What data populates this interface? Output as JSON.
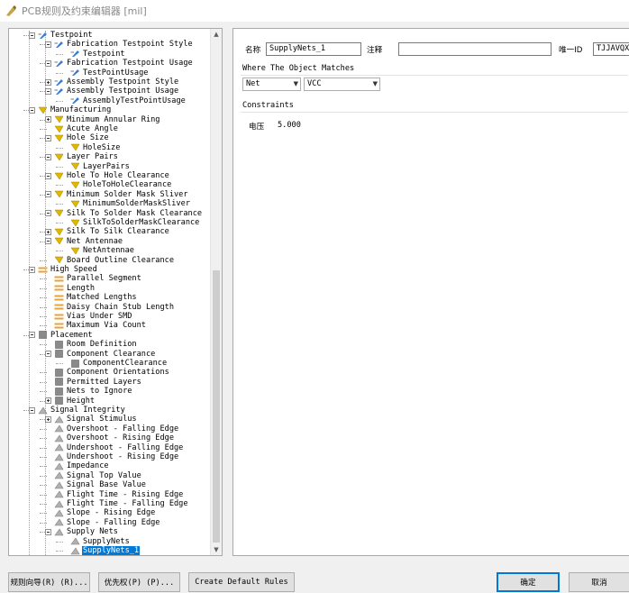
{
  "window": {
    "title": "PCB规则及约束编辑器 [mil]"
  },
  "tree": {
    "items": [
      {
        "label": "Testpoint",
        "level": 1,
        "expander": "minus",
        "icon": "rule"
      },
      {
        "label": "Fabrication Testpoint Style",
        "level": 2,
        "expander": "minus",
        "icon": "rule"
      },
      {
        "label": "Testpoint",
        "level": 3,
        "expander": "none",
        "icon": "rule-item"
      },
      {
        "label": "Fabrication Testpoint Usage",
        "level": 2,
        "expander": "minus",
        "icon": "rule"
      },
      {
        "label": "TestPointUsage",
        "level": 3,
        "expander": "none",
        "icon": "rule-item"
      },
      {
        "label": "Assembly Testpoint Style",
        "level": 2,
        "expander": "plus",
        "icon": "rule"
      },
      {
        "label": "Assembly Testpoint Usage",
        "level": 2,
        "expander": "minus",
        "icon": "rule"
      },
      {
        "label": "AssemblyTestPointUsage",
        "level": 3,
        "expander": "none",
        "icon": "rule-item"
      },
      {
        "label": "Manufacturing",
        "level": 1,
        "expander": "minus",
        "icon": "mfg"
      },
      {
        "label": "Minimum Annular Ring",
        "level": 2,
        "expander": "plus",
        "icon": "mfg"
      },
      {
        "label": "Acute Angle",
        "level": 2,
        "expander": "none",
        "icon": "mfg"
      },
      {
        "label": "Hole Size",
        "level": 2,
        "expander": "minus",
        "icon": "mfg"
      },
      {
        "label": "HoleSize",
        "level": 3,
        "expander": "none",
        "icon": "mfg-item"
      },
      {
        "label": "Layer Pairs",
        "level": 2,
        "expander": "minus",
        "icon": "mfg"
      },
      {
        "label": "LayerPairs",
        "level": 3,
        "expander": "none",
        "icon": "mfg-item"
      },
      {
        "label": "Hole To Hole Clearance",
        "level": 2,
        "expander": "minus",
        "icon": "mfg"
      },
      {
        "label": "HoleToHoleClearance",
        "level": 3,
        "expander": "none",
        "icon": "mfg-item"
      },
      {
        "label": "Minimum Solder Mask Sliver",
        "level": 2,
        "expander": "minus",
        "icon": "mfg"
      },
      {
        "label": "MinimumSolderMaskSliver",
        "level": 3,
        "expander": "none",
        "icon": "mfg-item"
      },
      {
        "label": "Silk To Solder Mask Clearance",
        "level": 2,
        "expander": "minus",
        "icon": "mfg"
      },
      {
        "label": "SilkToSolderMaskClearance",
        "level": 3,
        "expander": "none",
        "icon": "mfg-item"
      },
      {
        "label": "Silk To Silk Clearance",
        "level": 2,
        "expander": "plus",
        "icon": "mfg"
      },
      {
        "label": "Net Antennae",
        "level": 2,
        "expander": "minus",
        "icon": "mfg"
      },
      {
        "label": "NetAntennae",
        "level": 3,
        "expander": "none",
        "icon": "mfg-item"
      },
      {
        "label": "Board Outline Clearance",
        "level": 2,
        "expander": "none",
        "icon": "mfg"
      },
      {
        "label": "High Speed",
        "level": 1,
        "expander": "minus",
        "icon": "hs"
      },
      {
        "label": "Parallel Segment",
        "level": 2,
        "expander": "none",
        "icon": "hs"
      },
      {
        "label": "Length",
        "level": 2,
        "expander": "none",
        "icon": "hs"
      },
      {
        "label": "Matched Lengths",
        "level": 2,
        "expander": "none",
        "icon": "hs"
      },
      {
        "label": "Daisy Chain Stub Length",
        "level": 2,
        "expander": "none",
        "icon": "hs"
      },
      {
        "label": "Vias Under SMD",
        "level": 2,
        "expander": "none",
        "icon": "hs"
      },
      {
        "label": "Maximum Via Count",
        "level": 2,
        "expander": "none",
        "icon": "hs"
      },
      {
        "label": "Placement",
        "level": 1,
        "expander": "minus",
        "icon": "place"
      },
      {
        "label": "Room Definition",
        "level": 2,
        "expander": "none",
        "icon": "place"
      },
      {
        "label": "Component Clearance",
        "level": 2,
        "expander": "minus",
        "icon": "place"
      },
      {
        "label": "ComponentClearance",
        "level": 3,
        "expander": "none",
        "icon": "place-item"
      },
      {
        "label": "Component Orientations",
        "level": 2,
        "expander": "none",
        "icon": "place"
      },
      {
        "label": "Permitted Layers",
        "level": 2,
        "expander": "none",
        "icon": "place"
      },
      {
        "label": "Nets to Ignore",
        "level": 2,
        "expander": "none",
        "icon": "place"
      },
      {
        "label": "Height",
        "level": 2,
        "expander": "plus",
        "icon": "place"
      },
      {
        "label": "Signal Integrity",
        "level": 1,
        "expander": "minus",
        "icon": "si"
      },
      {
        "label": "Signal Stimulus",
        "level": 2,
        "expander": "plus",
        "icon": "si"
      },
      {
        "label": "Overshoot - Falling Edge",
        "level": 2,
        "expander": "none",
        "icon": "si"
      },
      {
        "label": "Overshoot - Rising Edge",
        "level": 2,
        "expander": "none",
        "icon": "si"
      },
      {
        "label": "Undershoot - Falling Edge",
        "level": 2,
        "expander": "none",
        "icon": "si"
      },
      {
        "label": "Undershoot - Rising Edge",
        "level": 2,
        "expander": "none",
        "icon": "si"
      },
      {
        "label": "Impedance",
        "level": 2,
        "expander": "none",
        "icon": "si"
      },
      {
        "label": "Signal Top Value",
        "level": 2,
        "expander": "none",
        "icon": "si"
      },
      {
        "label": "Signal Base Value",
        "level": 2,
        "expander": "none",
        "icon": "si"
      },
      {
        "label": "Flight Time - Rising Edge",
        "level": 2,
        "expander": "none",
        "icon": "si"
      },
      {
        "label": "Flight Time - Falling Edge",
        "level": 2,
        "expander": "none",
        "icon": "si"
      },
      {
        "label": "Slope - Rising Edge",
        "level": 2,
        "expander": "none",
        "icon": "si"
      },
      {
        "label": "Slope - Falling Edge",
        "level": 2,
        "expander": "none",
        "icon": "si"
      },
      {
        "label": "Supply Nets",
        "level": 2,
        "expander": "minus",
        "icon": "si"
      },
      {
        "label": "SupplyNets",
        "level": 3,
        "expander": "none",
        "icon": "si-item"
      },
      {
        "label": "SupplyNets_1",
        "level": 3,
        "expander": "none",
        "icon": "si-item",
        "selected": true
      }
    ]
  },
  "props": {
    "name_label": "名称",
    "name_value": "SupplyNets_1",
    "comment_label": "注释",
    "comment_value": "",
    "uid_label": "唯一ID",
    "uid_value": "TJJAVQXV",
    "where_header": "Where The Object Matches",
    "match_kind": "Net",
    "match_value": "VCC",
    "constraints_header": "Constraints",
    "voltage_label": "电压",
    "voltage_value": "5.000"
  },
  "buttons": {
    "rule_wizard": "规则向导(R) (R)...",
    "priorities": "优先权(P) (P)...",
    "create_default": "Create Default Rules",
    "ok": "确定",
    "cancel": "取消"
  },
  "colors": {
    "selection": "#0078d7",
    "rule": "#3a7bd5",
    "manufacturing": "#e0b800",
    "high_speed": "#e8a23c",
    "placement": "#8a8a8a",
    "signal_integrity": "#b0b0b0"
  }
}
